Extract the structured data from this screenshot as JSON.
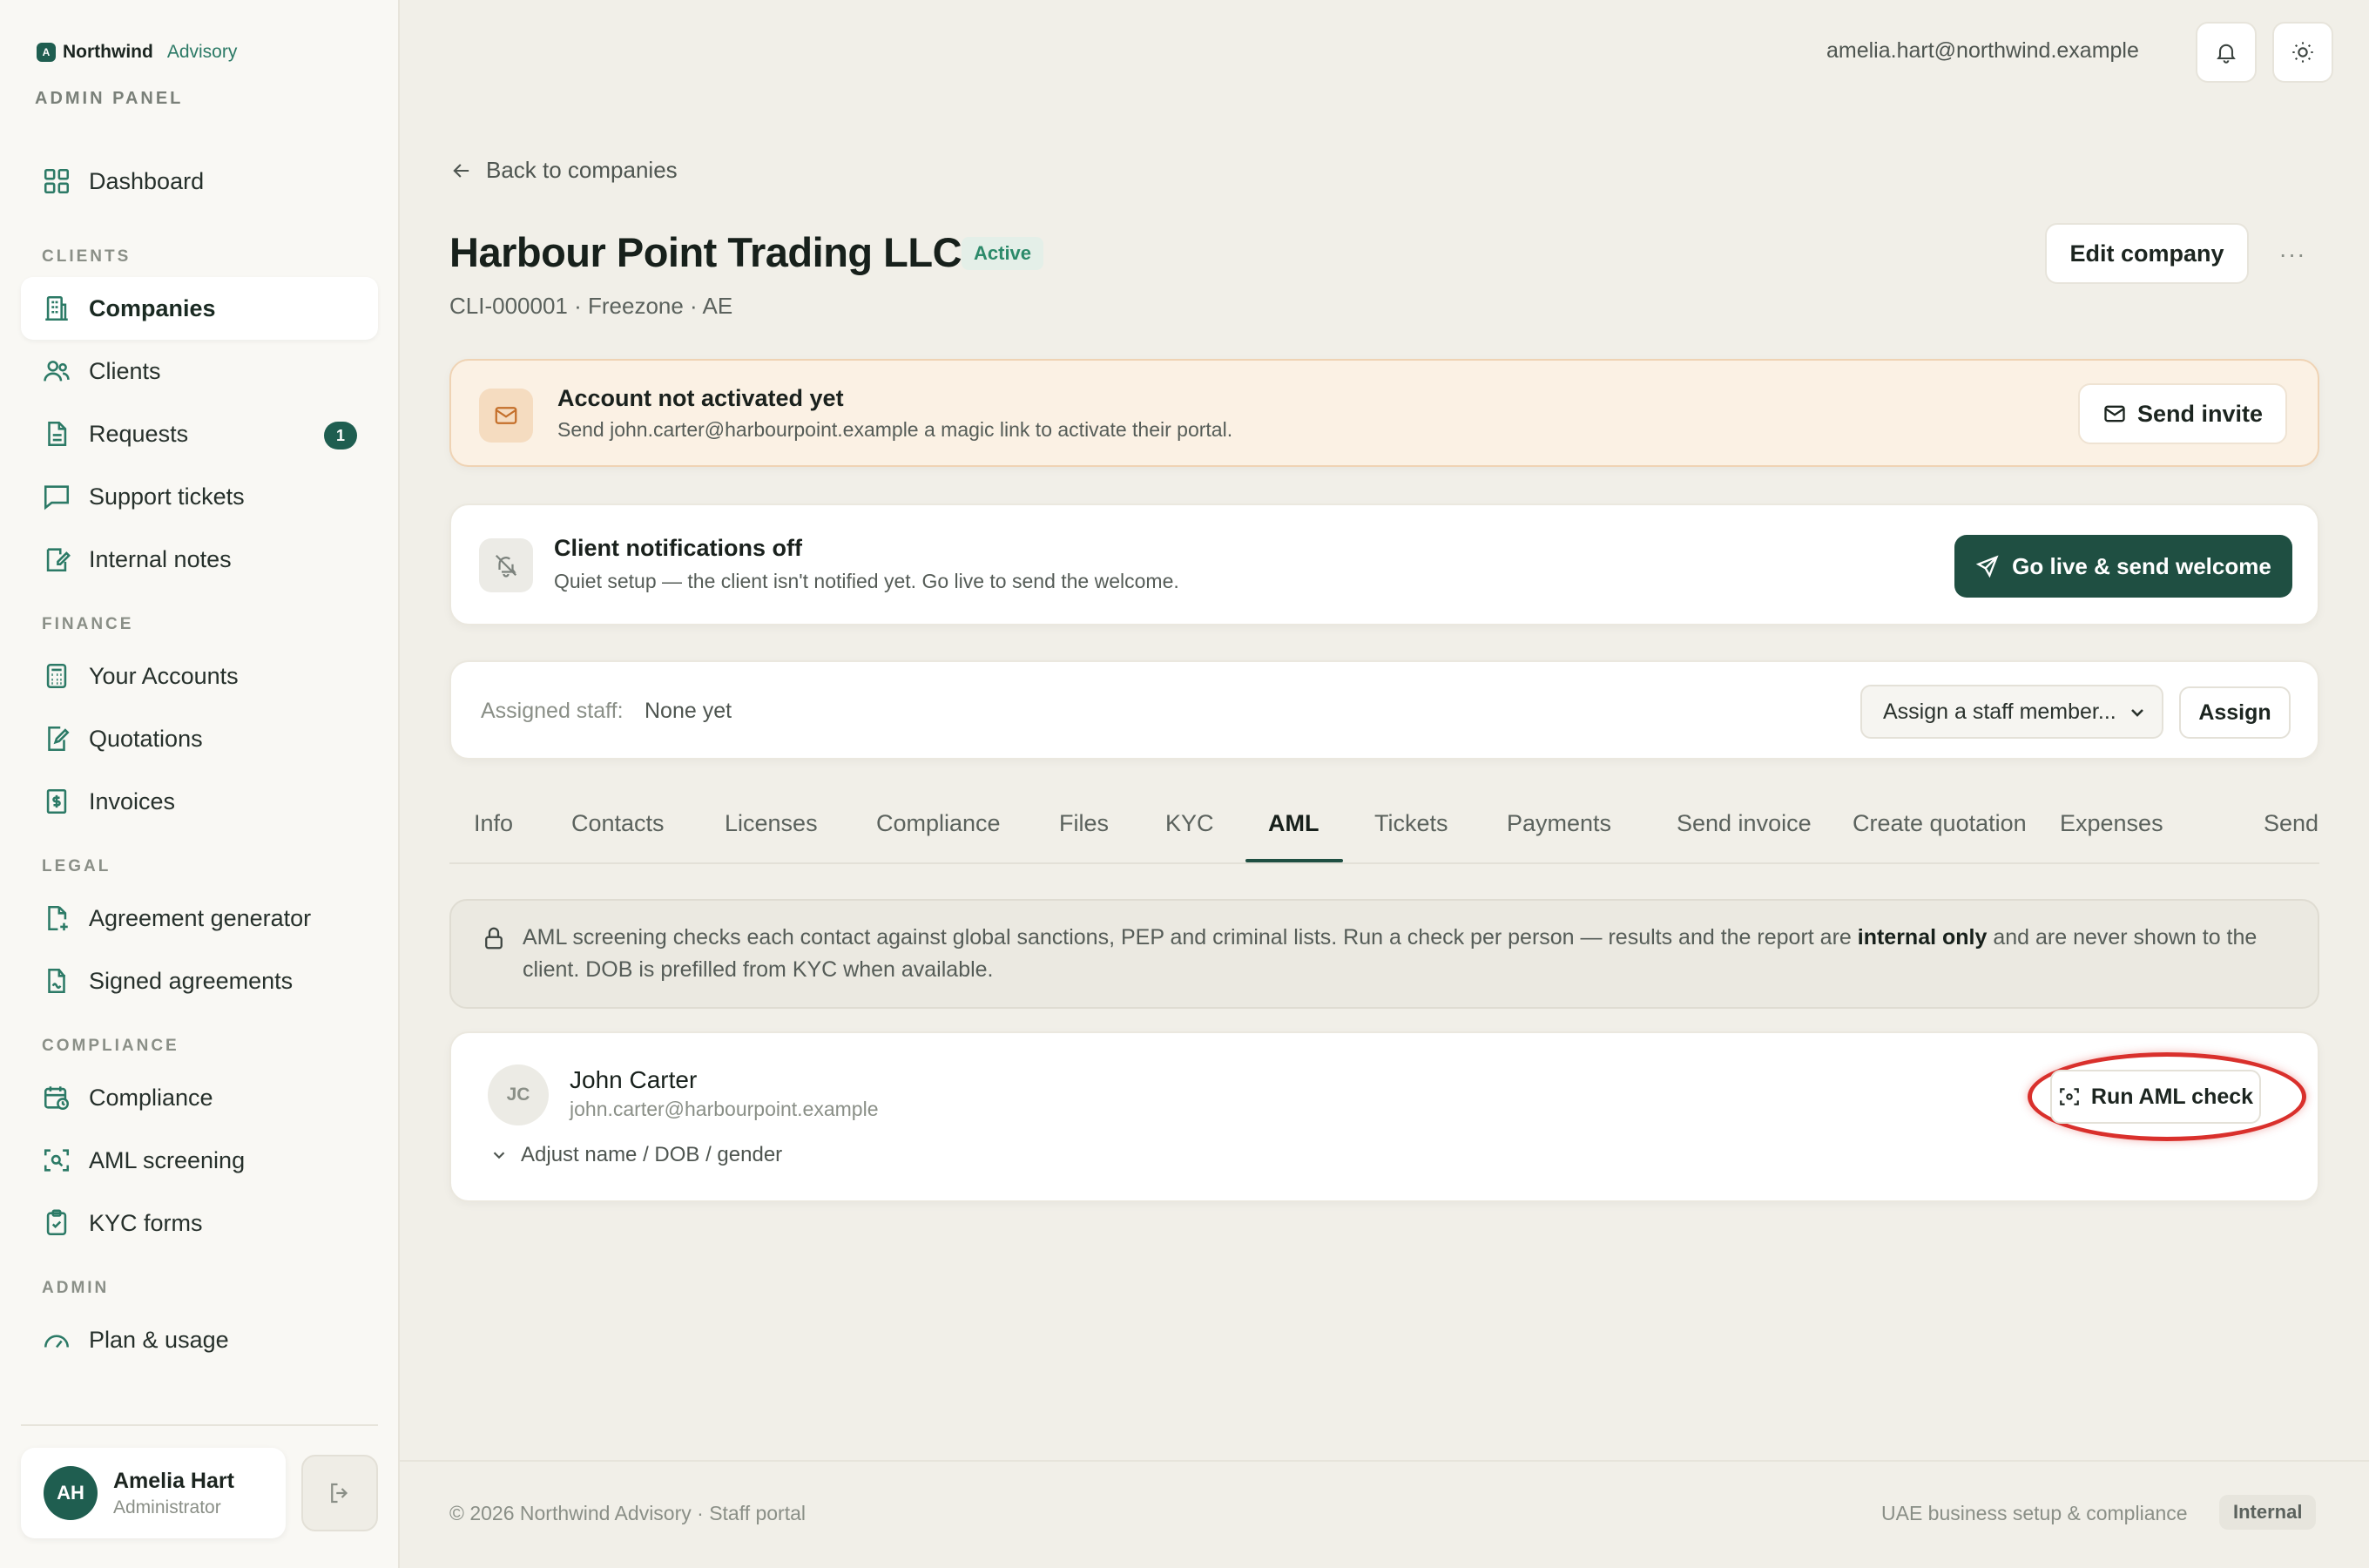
{
  "brand": {
    "mark": "A",
    "name": "Northwind",
    "sub": "Advisory",
    "panel_label": "ADMIN PANEL"
  },
  "nav": {
    "dashboard": "Dashboard",
    "sections": {
      "clients": "CLIENTS",
      "finance": "FINANCE",
      "legal": "LEGAL",
      "compliance": "COMPLIANCE",
      "admin": "ADMIN"
    },
    "items": {
      "companies": "Companies",
      "clients": "Clients",
      "requests": "Requests",
      "requests_badge": "1",
      "support_tickets": "Support tickets",
      "internal_notes": "Internal notes",
      "your_accounts": "Your Accounts",
      "quotations": "Quotations",
      "invoices": "Invoices",
      "agreement_generator": "Agreement generator",
      "signed_agreements": "Signed agreements",
      "compliance": "Compliance",
      "aml_screening": "AML screening",
      "kyc_forms": "KYC forms",
      "plan_usage": "Plan & usage"
    }
  },
  "user": {
    "initials": "AH",
    "name": "Amelia Hart",
    "role": "Administrator"
  },
  "topbar": {
    "email": "amelia.hart@northwind.example"
  },
  "page": {
    "back_label": "Back to companies",
    "title": "Harbour Point Trading LLC",
    "status": "Active",
    "subline": "CLI-000001 · Freezone · AE",
    "edit_label": "Edit company",
    "more_label": "···"
  },
  "activation_alert": {
    "title": "Account not activated yet",
    "text": "Send john.carter@harbourpoint.example a magic link to activate their portal.",
    "button": "Send invite"
  },
  "notifications": {
    "title": "Client notifications off",
    "text": "Quiet setup — the client isn't notified yet. Go live to send the welcome.",
    "button": "Go live & send welcome"
  },
  "staff": {
    "label": "Assigned staff:",
    "value": "None yet",
    "select_placeholder": "Assign a staff member...",
    "assign_label": "Assign"
  },
  "tabs": [
    "Info",
    "Contacts",
    "Licenses",
    "Compliance",
    "Files",
    "KYC",
    "AML",
    "Tickets",
    "Payments",
    "Send invoice",
    "Create quotation",
    "Expenses",
    "Send"
  ],
  "active_tab": "AML",
  "aml_note": {
    "part1": "AML screening checks each contact against global sanctions, PEP and criminal lists. Run a check per person — results and the report are ",
    "bold": "internal only",
    "part2": " and are never shown to the client. DOB is prefilled from KYC when available."
  },
  "contact": {
    "initials": "JC",
    "name": "John Carter",
    "email": "john.carter@harbourpoint.example",
    "adjust_label": "Adjust name / DOB / gender",
    "run_label": "Run AML check"
  },
  "footer": {
    "left": "© 2026 Northwind Advisory · Staff portal",
    "right": "UAE business setup & compliance",
    "pill": "Internal"
  },
  "colors": {
    "accent": "#1f5e50",
    "primary_button": "#1f4f42",
    "warning_bg": "#fbf1e4",
    "highlight": "#d9302c",
    "status_green": "#2c8a6a"
  }
}
